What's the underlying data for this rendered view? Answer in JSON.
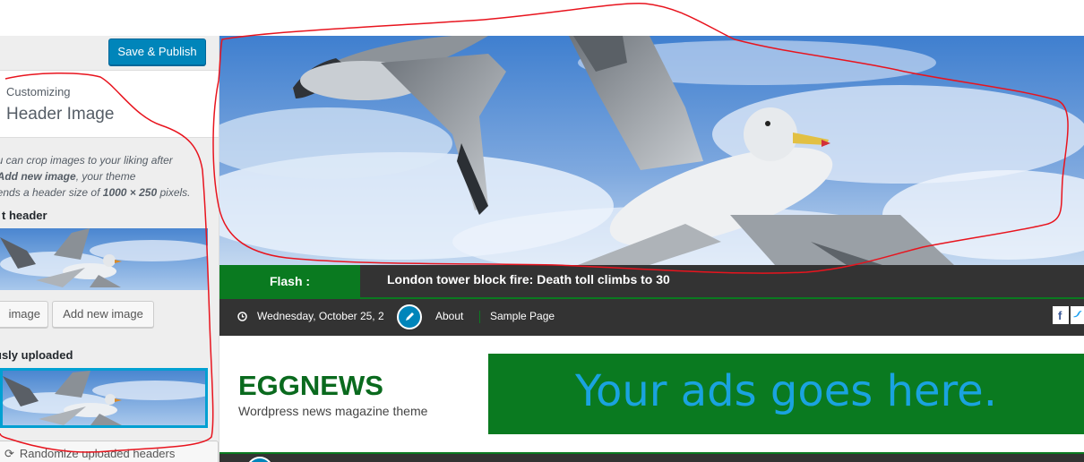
{
  "customizer": {
    "save_publish_label": "Save & Publish",
    "customizing_label": "Customizing",
    "section_title": "Header Image",
    "description": {
      "line1": "ou can crop images to your liking after",
      "line2_bold": "Add new image",
      "line2_rest": ", your theme",
      "line3_pre": "nends a header size of ",
      "line3_bold": "1000 × 250",
      "line3_post": " pixels."
    },
    "current_header_label": "t header",
    "hide_image_label": "image",
    "add_new_image_label": "Add new image",
    "previously_uploaded_label": "usly uploaded",
    "randomize_label": "Randomize uploaded headers"
  },
  "preview": {
    "flash_label": "Flash :",
    "flash_headline": "London tower block fire: Death toll climbs to 30",
    "date": "Wednesday, October 25, 2",
    "nav_about": "About",
    "nav_sample_page": "Sample Page",
    "site_title": "EGGNEWS",
    "tagline": "Wordpress news magazine theme",
    "ad_text": "Your ads goes here."
  },
  "colors": {
    "accent_blue": "#0085ba",
    "theme_green": "#0a7a20",
    "dark_bar": "#333333",
    "annotation_red": "#e8141e"
  },
  "icons": {
    "clock": "clock-icon",
    "pencil": "pencil-icon",
    "facebook": "facebook-icon",
    "twitter": "twitter-icon",
    "randomize": "refresh-icon"
  }
}
